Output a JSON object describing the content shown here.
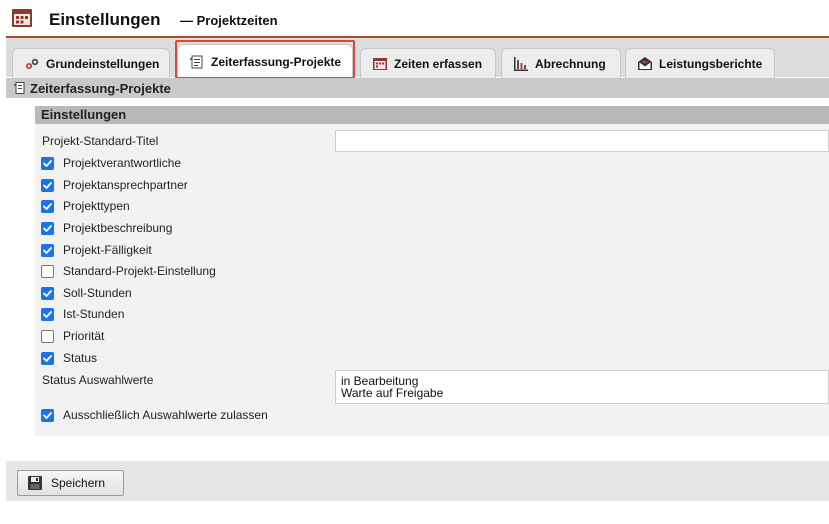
{
  "header": {
    "title": "Einstellungen",
    "subtitle": "— Projektzeiten",
    "app_icon": "calendar-icon"
  },
  "tabs": [
    {
      "label": "Grundeinstellungen",
      "icon": "gears-icon",
      "active": false
    },
    {
      "label": "Zeiterfassung-Projekte",
      "icon": "document-list-icon",
      "active": true
    },
    {
      "label": "Zeiten erfassen",
      "icon": "calendar-icon",
      "active": false
    },
    {
      "label": "Abrechnung",
      "icon": "chart-icon",
      "active": false
    },
    {
      "label": "Leistungsberichte",
      "icon": "envelope-icon",
      "active": false
    }
  ],
  "section": {
    "title": "Zeiterfassung-Projekte",
    "icon": "document-list-icon"
  },
  "panel": {
    "title": "Einstellungen",
    "standard_title_label": "Projekt-Standard-Titel",
    "standard_title_value": "",
    "options": [
      {
        "label": "Projektverantwortliche",
        "checked": true
      },
      {
        "label": "Projektansprechpartner",
        "checked": true
      },
      {
        "label": "Projekttypen",
        "checked": true
      },
      {
        "label": "Projektbeschreibung",
        "checked": true
      },
      {
        "label": "Projekt-Fälligkeit",
        "checked": true
      },
      {
        "label": "Standard-Projekt-Einstellung",
        "checked": false
      },
      {
        "label": "Soll-Stunden",
        "checked": true
      },
      {
        "label": "Ist-Stunden",
        "checked": true
      },
      {
        "label": "Priorität",
        "checked": false
      },
      {
        "label": "Status",
        "checked": true
      }
    ],
    "status_values_label": "Status Auswahlwerte",
    "status_values": "in Bearbeitung\nWarte auf Freigabe",
    "only_values": {
      "label": "Ausschließlich Auswahlwerte zulassen",
      "checked": true
    }
  },
  "footer": {
    "save_label": "Speichern",
    "save_icon": "floppy-disk-icon"
  },
  "colors": {
    "accent_border": "#a0522d",
    "highlight": "#e0453a",
    "checkbox": "#1a73e8"
  }
}
